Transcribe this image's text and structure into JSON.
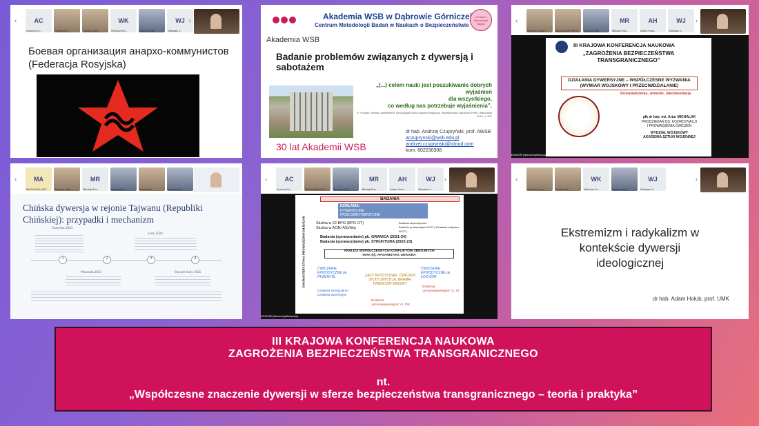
{
  "tiles": {
    "t1": {
      "participants": [
        {
          "initials": "AC",
          "name": "Andrzej Cz..."
        },
        {
          "initials": "",
          "name": "Paulina Ro..."
        },
        {
          "initials": "",
          "name": "Tomasz Ceb..."
        },
        {
          "initials": "WK",
          "name": "Wikroda Ko..."
        },
        {
          "initials": "",
          "name": "Adam Hołub"
        },
        {
          "initials": "WJ",
          "name": "Wiesław J..."
        }
      ],
      "title": "Боевая организация анархо-коммунистов (Federacja Rosyjska)"
    },
    "t2": {
      "logo_text": "Akademia WSB",
      "header_title": "Akademia WSB w Dąbrowie Górniczej",
      "header_sub": "Centrum Metodologii Badań w Naukach o Bezpieczeństwie",
      "badge": "Centrum Metodologii Badań",
      "title": "Badanie problemów związanych z dywersją i sabotażem",
      "quote1": "„(...) celem nauki jest poszukiwanie dobrych wyjaśnień",
      "quote2": "dla wszystkiego,",
      "quote3": "co według nas potrzebuje wyjaśnienia”.",
      "quote_src": "K. Popper, Wiedza obiektywna. Ewolucyjna teoria epistemologiczna, Wydawnictwo Naukowe PWN, Warszawa 2012, s. 231",
      "author": "dr hab. Andrzej Czupryński, prof. AWSB",
      "email1": "aczuprynski@wsb.edu.pl",
      "email2": "andrzej.czuprynski@icloud.com",
      "phone": "kom. 602230308",
      "footer_logo": "30 lat Akademii WSB"
    },
    "t3": {
      "participants": [
        {
          "initials": "",
          "name": "Andrzej Czupr..."
        },
        {
          "initials": "",
          "name": "MICHALAK PROD..."
        },
        {
          "initials": "",
          "name": "Tomasz Ceb..."
        },
        {
          "initials": "MR",
          "name": "Mikołaj Rus..."
        },
        {
          "initials": "AH",
          "name": "Adam Hołu..."
        },
        {
          "initials": "WJ",
          "name": "Wiesław J..."
        }
      ],
      "conf": "III KRAJOWA KONFERENCJA NAUKOWA",
      "topic1": "„ZAGROŻENIA BEZPIECZEŃSTWA",
      "topic2": "TRANSGRANICZNEGO”",
      "box1": "DZIAŁANIA DYWERSYJNE – WSPÓŁCZESNE WYZWANIA",
      "box2": "(WYMIAR WOJSKOWY I PRZECIWDZIAŁANIE)",
      "sub": "Doświadczenia, wnioski, rekomendacje",
      "author": "płk dr hab. inż. Artur MICHALAK",
      "role1": "PRODZIEKAN DS. KOORDYNACJI",
      "role2": "I PROWADZENIA ĆWICZEŃ",
      "role3": "WYDZIAŁ WOJSKOWY",
      "role4": "AKADEMIA SZTUKI WOJENNEJ",
      "owner": "EXATUR (Nieczemy/Brusowa)"
    },
    "t4": {
      "participants": [
        {
          "initials": "MA",
          "name": "MICHALAK ART..."
        },
        {
          "initials": "",
          "name": "Tomasz Ceb..."
        },
        {
          "initials": "MR",
          "name": "Mikołaj Rus..."
        },
        {
          "initials": "",
          "name": "Adam Hołu..."
        },
        {
          "initials": "",
          "name": "Wiesław J..."
        },
        {
          "initials": "",
          "name": "Dariusz Tur..."
        }
      ],
      "title": "Chińska dywersja w rejonie Tajwanu (Republiki Chińskiej): przypadki i mechanizm",
      "tl": [
        {
          "n": "1",
          "date": "Czerwiec 2023"
        },
        {
          "n": "2",
          "date": "Wrzesień 2023"
        },
        {
          "n": "3",
          "date": "Luty 2024"
        },
        {
          "n": "4",
          "date": "Styczeń-Luty 2025"
        }
      ]
    },
    "t5": {
      "participants": [
        {
          "initials": "AC",
          "name": "Andrzej Cz..."
        },
        {
          "initials": "",
          "name": "MICHALAK PRO..."
        },
        {
          "initials": "",
          "name": "Tomasz Ceb..."
        },
        {
          "initials": "MR",
          "name": "Mikołaj Rus..."
        },
        {
          "initials": "AH",
          "name": "Adam Hołu..."
        },
        {
          "initials": "WJ",
          "name": "Wiesław J..."
        }
      ],
      "badania": "BADANIA",
      "dzialania": "DZIAŁANIA:",
      "d1": "DYWERSYJNE",
      "d2": "PRZECIWDYWERSYJNE",
      "vertical": "CHARAKTERYSTYKA PROWADZONYCH BADAŃ",
      "items_left": [
        "Służba w 22 BPG (BPG OT)",
        "Służba w AON/ ASzWoj"
      ],
      "items_right": [
        "Badania asymetryczne",
        "Badania problematyka WOT („Działania bałtyckie WOT”)"
      ],
      "g1": "Badania (sprawozdanie) pk. GRANICA (2021-24)",
      "g2": "Badania (sprawozdanie) pk. STRUKTURA (2022-23)",
      "analiza": "ANALIZA WSPÓŁCZESNYCH KONFLIKTÓW ZBROJNYCH",
      "analiza2": "IRAK (II), AFGANISTAN, UKRAINA",
      "c1": "ĆWICZENIE EPIZODYCZNE pk. PRZEMYŚL",
      "c2": "„FAZY KRYZYSOWE” ĆWICZEŃ STUDYJNYCH pk. BRAMA/ TWIERDZA/ MAZURY",
      "c3": "ĆWICZENIE EPIZODYCZNE pk. ŁOCHÓW",
      "e1": "Działania nieregularne Działania dywersyjne",
      "e2": "Działania „przeciwdywersyjne” cz. P/K",
      "e3": "Działania „przeciwdywersyjne” cz. W",
      "owner": "EXATUR (Nieczemy/Brusowa)"
    },
    "t6": {
      "participants": [
        {
          "initials": "",
          "name": "Andrzej Czupr..."
        },
        {
          "initials": "",
          "name": "Paulina Ro..."
        },
        {
          "initials": "WK",
          "name": "Wikroda Ko..."
        },
        {
          "initials": "",
          "name": "Adam Hołub"
        },
        {
          "initials": "WJ",
          "name": "Wiesław J..."
        }
      ],
      "title1": "Ekstremizm i radykalizm w",
      "title2": "kontekście dywersji",
      "title3": "ideologicznej",
      "author": "dr hab. Adam Hołub, prof. UMK"
    }
  },
  "banner": {
    "line1": "III KRAJOWA KONFERENCJA NAUKOWA",
    "line2": "ZAGROŻENIA BEZPIECZEŃSTWA TRANSGRANICZNEGO",
    "line3": "nt.",
    "line4": "„Współczesne znaczenie dywersji w sferze bezpieczeństwa transgranicznego – teoria i praktyka”"
  },
  "colors": {
    "banner_bg": "#cf1259",
    "star_red": "#e52a1f",
    "wsb_blue": "#1f3f8f",
    "badania_red": "#c0392b"
  }
}
